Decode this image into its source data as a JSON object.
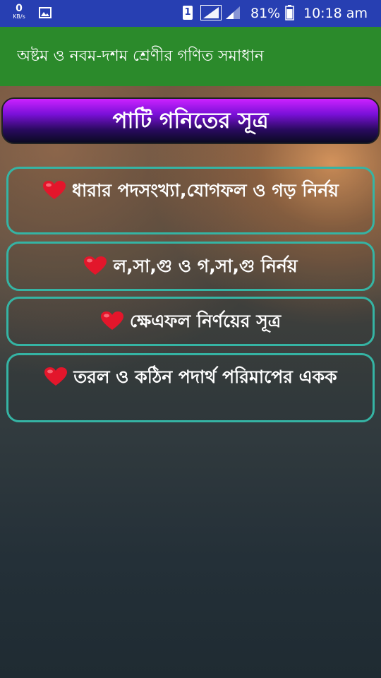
{
  "status_bar": {
    "speed_value": "0",
    "speed_unit": "KB/s",
    "sim_number": "1",
    "battery": "81%",
    "time": "10:18 am",
    "icons": [
      "gallery-icon",
      "signal-icon",
      "battery-icon"
    ]
  },
  "app_bar": {
    "title": "অষ্টম ও নবম-দশম শ্রেণীর গণিত সমাধান"
  },
  "header": {
    "title": "পাটি গনিতের সূত্র"
  },
  "menu": {
    "items": [
      {
        "label": "ধারার পদসংখ্যা,যোগফল ও গড় নির্নয়"
      },
      {
        "label": "ল,সা,গু ও গ,সা,গু নির্নয়"
      },
      {
        "label": "ক্ষেএফল নির্ণয়ের সূত্র"
      },
      {
        "label": "তরল ও কঠিন পদার্থ পরিমাপের একক"
      }
    ]
  },
  "colors": {
    "status_bar": "#273fb2",
    "app_bar": "#2b8a2b",
    "item_border": "#35b4a4",
    "banner_top": "#cc22ff",
    "heart": "#e3162b"
  }
}
